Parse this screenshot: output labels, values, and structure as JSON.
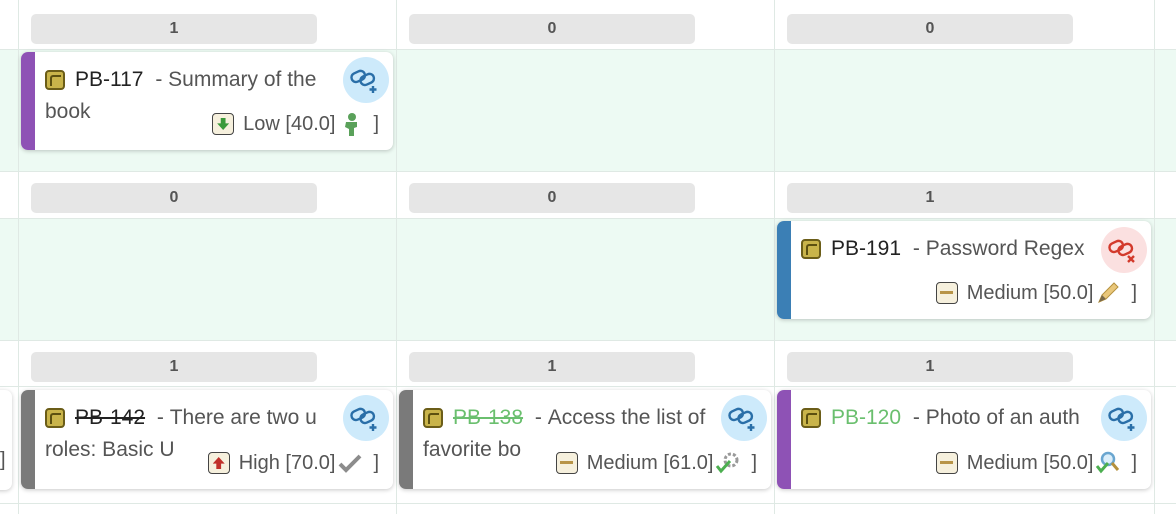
{
  "colors": {
    "lane_bg": "#edfaf3",
    "purple": "#8e52b5",
    "blue": "#3b7fb5",
    "grey": "#7a7a7a",
    "link_bg": "#cdeafb",
    "unlink_bg": "#fbe0e0"
  },
  "rows": [
    {
      "counts": [
        "1",
        "0",
        "0"
      ]
    },
    {
      "counts": [
        "0",
        "0",
        "1"
      ]
    },
    {
      "counts": [
        "1",
        "1",
        "1"
      ]
    }
  ],
  "cards": [
    {
      "key": "PB-117",
      "separator": " - ",
      "summary_line1": "Summary of the",
      "summary_line2": "book",
      "priority_label": "Low [40.0]",
      "bracket": "]",
      "priority": "low",
      "status_icon": "person-icon",
      "link_icon": "link-add-icon"
    },
    {
      "key": "PB-191",
      "separator": " - ",
      "summary_line1": "Password Regex",
      "summary_line2": "",
      "priority_label": "Medium [50.0]",
      "bracket": "]",
      "priority": "medium",
      "status_icon": "pencil-icon",
      "link_icon": "link-remove-icon"
    },
    {
      "key": "PB-142",
      "separator": " - ",
      "summary_line1": "There are two u",
      "summary_line2": "roles: Basic U",
      "priority_label": "High [70.0]",
      "bracket": "]",
      "priority": "high",
      "status_icon": "check-icon",
      "link_icon": "link-add-icon"
    },
    {
      "key": "PB-138",
      "separator": " - ",
      "summary_line1": "Access the list of",
      "summary_line2": "favorite bo",
      "priority_label": "Medium [61.0]",
      "bracket": "]",
      "priority": "medium",
      "status_icon": "gear-check-icon",
      "link_icon": "link-add-icon"
    },
    {
      "key": "PB-120",
      "separator": " - ",
      "summary_line1": "Photo of an auth",
      "summary_line2": "",
      "priority_label": "Medium [50.0]",
      "bracket": "]",
      "priority": "medium",
      "status_icon": "magnifier-check-icon",
      "link_icon": "link-add-icon"
    }
  ]
}
